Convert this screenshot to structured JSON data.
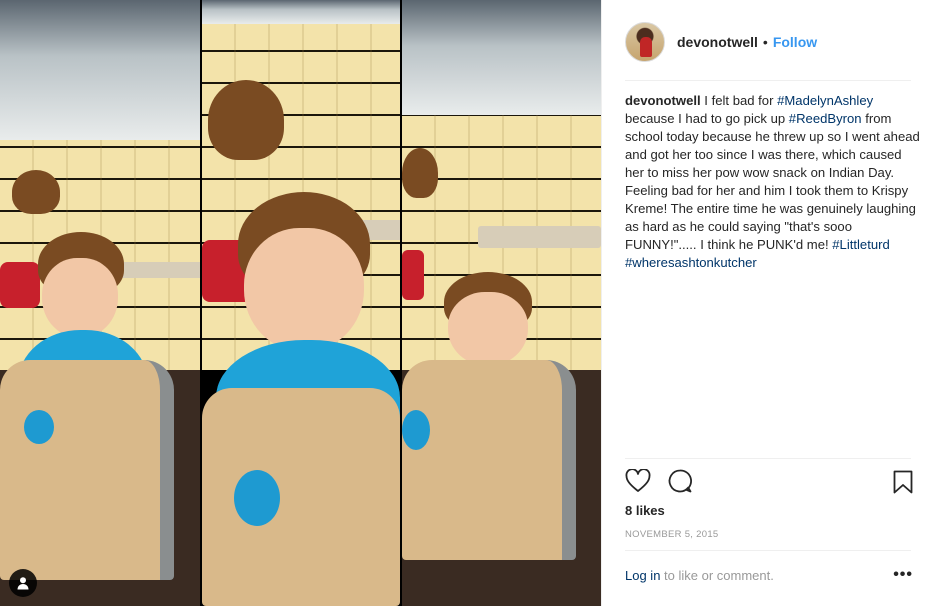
{
  "post": {
    "media": {
      "profile_icon": "user-silhouette-icon"
    },
    "header": {
      "username": "devonotwell",
      "separator": "•",
      "follow_label": "Follow"
    },
    "caption": {
      "username": "devonotwell",
      "t1": " I felt bad for ",
      "tag1": "#MadelynAshley",
      "t2": " because I had to go pick up ",
      "tag2": "#ReedByron",
      "t3": " from school today because he threw up so I went ahead and got her too since I was there, which caused her to miss her pow wow snack on Indian Day. Feeling bad for her and him I took them to Krispy Kreme! The entire time he was genuinely laughing as hard as he could saying \"that's sooo FUNNY!\"..... I think he PUNK'd me! ",
      "tag3": "#Littleturd",
      "tag4": "#wheresashtonkutcher"
    },
    "likes": "8 likes",
    "date": "November 5, 2015",
    "login": {
      "link": "Log in",
      "rest": " to like or comment."
    },
    "more": "•••",
    "colors": {
      "link": "#003569",
      "follow": "#3897f0",
      "muted": "#999999"
    }
  }
}
